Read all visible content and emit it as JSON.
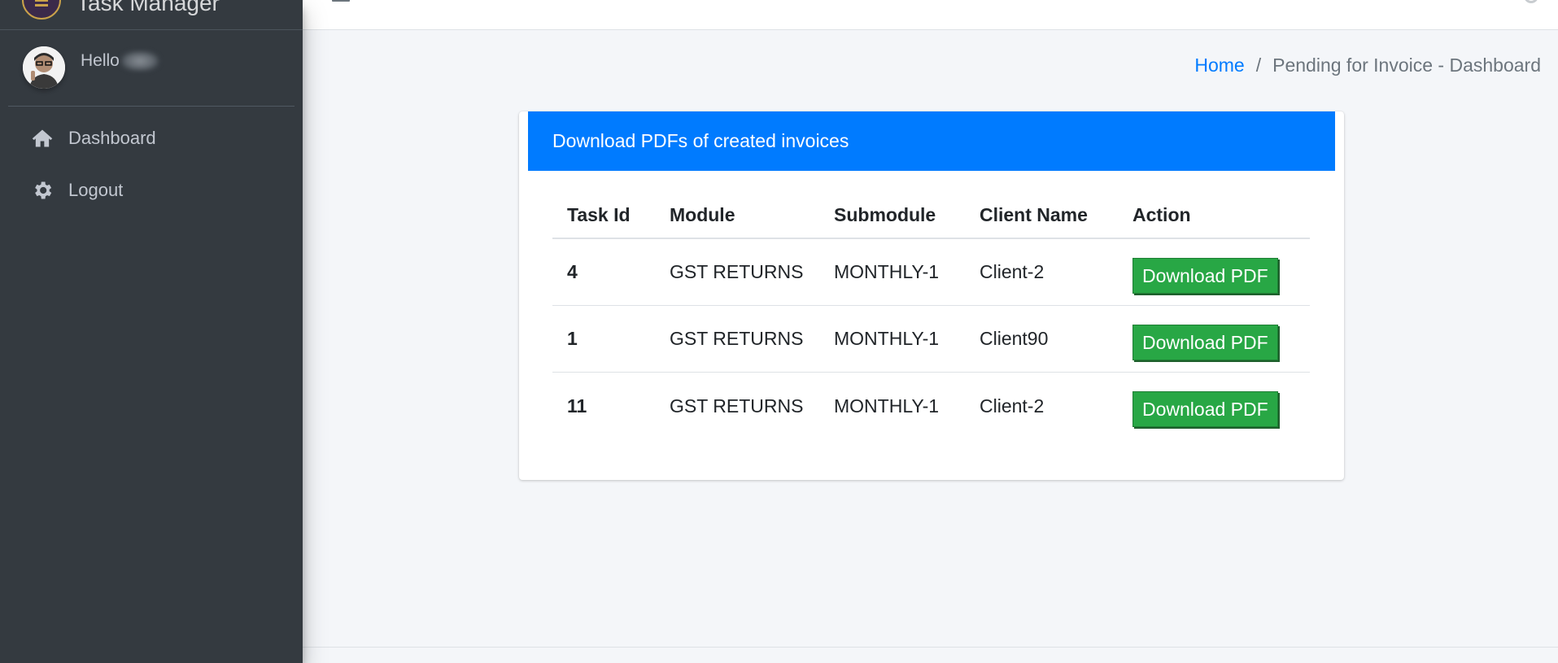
{
  "app": {
    "brand_text": "Task Manager"
  },
  "sidebar": {
    "user_greeting": "Hello",
    "items": [
      {
        "label": "Dashboard",
        "icon": "home-icon"
      },
      {
        "label": "Logout",
        "icon": "gear-icon"
      }
    ]
  },
  "breadcrumb": {
    "home": "Home",
    "separator": "/",
    "current": "Pending for Invoice - Dashboard"
  },
  "card": {
    "title": "Download PDFs of created invoices",
    "header_color": "#007bff"
  },
  "table": {
    "columns": [
      "Task Id",
      "Module",
      "Submodule",
      "Client Name",
      "Action"
    ],
    "rows": [
      {
        "task_id": "4",
        "module": "GST RETURNS",
        "submodule": "MONTHLY-1",
        "client": "Client-2",
        "action": "Download PDF"
      },
      {
        "task_id": "1",
        "module": "GST RETURNS",
        "submodule": "MONTHLY-1",
        "client": "Client90",
        "action": "Download PDF"
      },
      {
        "task_id": "11",
        "module": "GST RETURNS",
        "submodule": "MONTHLY-1",
        "client": "Client-2",
        "action": "Download PDF"
      }
    ]
  },
  "colors": {
    "sidebar_bg": "#343a40",
    "accent": "#007bff",
    "button_success": "#28a745"
  }
}
